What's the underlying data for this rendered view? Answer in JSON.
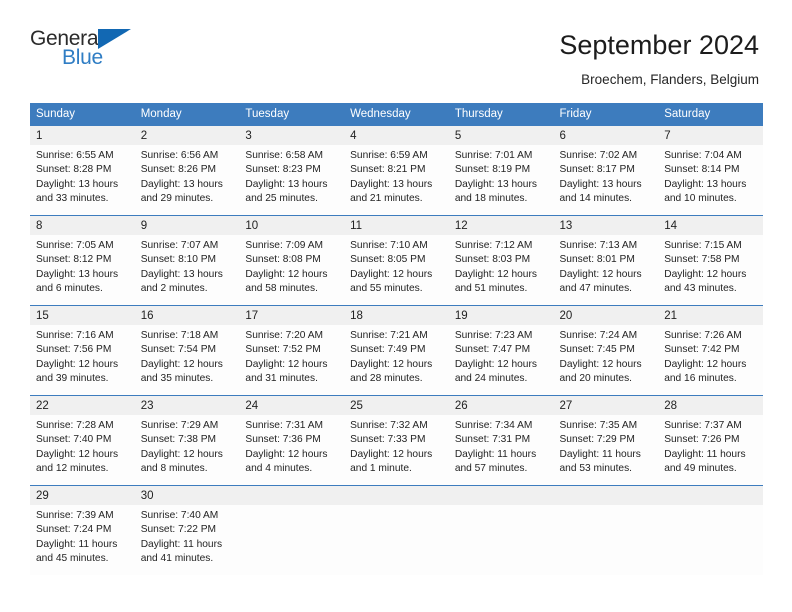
{
  "brand": {
    "name_top": "General",
    "name_bottom": "Blue",
    "triangle_color": "#1268b3",
    "blue_text_color": "#2f7dc4"
  },
  "header": {
    "title": "September 2024",
    "subtitle": "Broechem, Flanders, Belgium"
  },
  "theme": {
    "header_blue": "#3d7cbe",
    "daynum_band": "#f0f0f0",
    "cell_background": "#fdfdfd",
    "text": "#232323"
  },
  "weekdays": [
    "Sunday",
    "Monday",
    "Tuesday",
    "Wednesday",
    "Thursday",
    "Friday",
    "Saturday"
  ],
  "weeks": [
    [
      {
        "day": "1",
        "sunrise": "Sunrise: 6:55 AM",
        "sunset": "Sunset: 8:28 PM",
        "daylight_line1": "Daylight: 13 hours",
        "daylight_line2": "and 33 minutes."
      },
      {
        "day": "2",
        "sunrise": "Sunrise: 6:56 AM",
        "sunset": "Sunset: 8:26 PM",
        "daylight_line1": "Daylight: 13 hours",
        "daylight_line2": "and 29 minutes."
      },
      {
        "day": "3",
        "sunrise": "Sunrise: 6:58 AM",
        "sunset": "Sunset: 8:23 PM",
        "daylight_line1": "Daylight: 13 hours",
        "daylight_line2": "and 25 minutes."
      },
      {
        "day": "4",
        "sunrise": "Sunrise: 6:59 AM",
        "sunset": "Sunset: 8:21 PM",
        "daylight_line1": "Daylight: 13 hours",
        "daylight_line2": "and 21 minutes."
      },
      {
        "day": "5",
        "sunrise": "Sunrise: 7:01 AM",
        "sunset": "Sunset: 8:19 PM",
        "daylight_line1": "Daylight: 13 hours",
        "daylight_line2": "and 18 minutes."
      },
      {
        "day": "6",
        "sunrise": "Sunrise: 7:02 AM",
        "sunset": "Sunset: 8:17 PM",
        "daylight_line1": "Daylight: 13 hours",
        "daylight_line2": "and 14 minutes."
      },
      {
        "day": "7",
        "sunrise": "Sunrise: 7:04 AM",
        "sunset": "Sunset: 8:14 PM",
        "daylight_line1": "Daylight: 13 hours",
        "daylight_line2": "and 10 minutes."
      }
    ],
    [
      {
        "day": "8",
        "sunrise": "Sunrise: 7:05 AM",
        "sunset": "Sunset: 8:12 PM",
        "daylight_line1": "Daylight: 13 hours",
        "daylight_line2": "and 6 minutes."
      },
      {
        "day": "9",
        "sunrise": "Sunrise: 7:07 AM",
        "sunset": "Sunset: 8:10 PM",
        "daylight_line1": "Daylight: 13 hours",
        "daylight_line2": "and 2 minutes."
      },
      {
        "day": "10",
        "sunrise": "Sunrise: 7:09 AM",
        "sunset": "Sunset: 8:08 PM",
        "daylight_line1": "Daylight: 12 hours",
        "daylight_line2": "and 58 minutes."
      },
      {
        "day": "11",
        "sunrise": "Sunrise: 7:10 AM",
        "sunset": "Sunset: 8:05 PM",
        "daylight_line1": "Daylight: 12 hours",
        "daylight_line2": "and 55 minutes."
      },
      {
        "day": "12",
        "sunrise": "Sunrise: 7:12 AM",
        "sunset": "Sunset: 8:03 PM",
        "daylight_line1": "Daylight: 12 hours",
        "daylight_line2": "and 51 minutes."
      },
      {
        "day": "13",
        "sunrise": "Sunrise: 7:13 AM",
        "sunset": "Sunset: 8:01 PM",
        "daylight_line1": "Daylight: 12 hours",
        "daylight_line2": "and 47 minutes."
      },
      {
        "day": "14",
        "sunrise": "Sunrise: 7:15 AM",
        "sunset": "Sunset: 7:58 PM",
        "daylight_line1": "Daylight: 12 hours",
        "daylight_line2": "and 43 minutes."
      }
    ],
    [
      {
        "day": "15",
        "sunrise": "Sunrise: 7:16 AM",
        "sunset": "Sunset: 7:56 PM",
        "daylight_line1": "Daylight: 12 hours",
        "daylight_line2": "and 39 minutes."
      },
      {
        "day": "16",
        "sunrise": "Sunrise: 7:18 AM",
        "sunset": "Sunset: 7:54 PM",
        "daylight_line1": "Daylight: 12 hours",
        "daylight_line2": "and 35 minutes."
      },
      {
        "day": "17",
        "sunrise": "Sunrise: 7:20 AM",
        "sunset": "Sunset: 7:52 PM",
        "daylight_line1": "Daylight: 12 hours",
        "daylight_line2": "and 31 minutes."
      },
      {
        "day": "18",
        "sunrise": "Sunrise: 7:21 AM",
        "sunset": "Sunset: 7:49 PM",
        "daylight_line1": "Daylight: 12 hours",
        "daylight_line2": "and 28 minutes."
      },
      {
        "day": "19",
        "sunrise": "Sunrise: 7:23 AM",
        "sunset": "Sunset: 7:47 PM",
        "daylight_line1": "Daylight: 12 hours",
        "daylight_line2": "and 24 minutes."
      },
      {
        "day": "20",
        "sunrise": "Sunrise: 7:24 AM",
        "sunset": "Sunset: 7:45 PM",
        "daylight_line1": "Daylight: 12 hours",
        "daylight_line2": "and 20 minutes."
      },
      {
        "day": "21",
        "sunrise": "Sunrise: 7:26 AM",
        "sunset": "Sunset: 7:42 PM",
        "daylight_line1": "Daylight: 12 hours",
        "daylight_line2": "and 16 minutes."
      }
    ],
    [
      {
        "day": "22",
        "sunrise": "Sunrise: 7:28 AM",
        "sunset": "Sunset: 7:40 PM",
        "daylight_line1": "Daylight: 12 hours",
        "daylight_line2": "and 12 minutes."
      },
      {
        "day": "23",
        "sunrise": "Sunrise: 7:29 AM",
        "sunset": "Sunset: 7:38 PM",
        "daylight_line1": "Daylight: 12 hours",
        "daylight_line2": "and 8 minutes."
      },
      {
        "day": "24",
        "sunrise": "Sunrise: 7:31 AM",
        "sunset": "Sunset: 7:36 PM",
        "daylight_line1": "Daylight: 12 hours",
        "daylight_line2": "and 4 minutes."
      },
      {
        "day": "25",
        "sunrise": "Sunrise: 7:32 AM",
        "sunset": "Sunset: 7:33 PM",
        "daylight_line1": "Daylight: 12 hours",
        "daylight_line2": "and 1 minute."
      },
      {
        "day": "26",
        "sunrise": "Sunrise: 7:34 AM",
        "sunset": "Sunset: 7:31 PM",
        "daylight_line1": "Daylight: 11 hours",
        "daylight_line2": "and 57 minutes."
      },
      {
        "day": "27",
        "sunrise": "Sunrise: 7:35 AM",
        "sunset": "Sunset: 7:29 PM",
        "daylight_line1": "Daylight: 11 hours",
        "daylight_line2": "and 53 minutes."
      },
      {
        "day": "28",
        "sunrise": "Sunrise: 7:37 AM",
        "sunset": "Sunset: 7:26 PM",
        "daylight_line1": "Daylight: 11 hours",
        "daylight_line2": "and 49 minutes."
      }
    ],
    [
      {
        "day": "29",
        "sunrise": "Sunrise: 7:39 AM",
        "sunset": "Sunset: 7:24 PM",
        "daylight_line1": "Daylight: 11 hours",
        "daylight_line2": "and 45 minutes."
      },
      {
        "day": "30",
        "sunrise": "Sunrise: 7:40 AM",
        "sunset": "Sunset: 7:22 PM",
        "daylight_line1": "Daylight: 11 hours",
        "daylight_line2": "and 41 minutes."
      },
      {
        "day": "",
        "sunrise": "",
        "sunset": "",
        "daylight_line1": "",
        "daylight_line2": ""
      },
      {
        "day": "",
        "sunrise": "",
        "sunset": "",
        "daylight_line1": "",
        "daylight_line2": ""
      },
      {
        "day": "",
        "sunrise": "",
        "sunset": "",
        "daylight_line1": "",
        "daylight_line2": ""
      },
      {
        "day": "",
        "sunrise": "",
        "sunset": "",
        "daylight_line1": "",
        "daylight_line2": ""
      },
      {
        "day": "",
        "sunrise": "",
        "sunset": "",
        "daylight_line1": "",
        "daylight_line2": ""
      }
    ]
  ]
}
